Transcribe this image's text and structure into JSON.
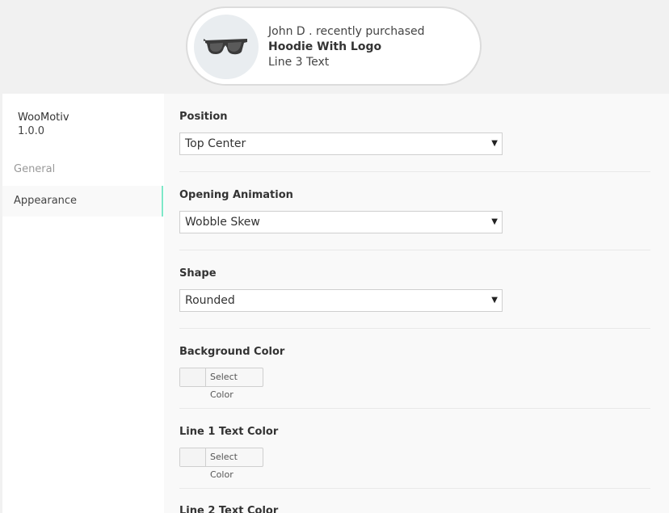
{
  "preview": {
    "image_icon": "sunglasses-icon",
    "line1": "John D . recently purchased",
    "line2": "Hoodie With Logo",
    "line3": "Line 3 Text"
  },
  "sidebar": {
    "plugin_name": "WooMotiv",
    "version": "1.0.0",
    "items": [
      {
        "label": "General",
        "active": false
      },
      {
        "label": "Appearance",
        "active": true
      }
    ],
    "accent_color": "#7ee8c8"
  },
  "settings": {
    "position": {
      "label": "Position",
      "value": "Top Center"
    },
    "opening_animation": {
      "label": "Opening Animation",
      "value": "Wobble Skew"
    },
    "shape": {
      "label": "Shape",
      "value": "Rounded"
    },
    "background_color": {
      "label": "Background Color",
      "button": "Select Color"
    },
    "line1_color": {
      "label": "Line 1 Text Color",
      "button": "Select Color"
    },
    "line2_color": {
      "label": "Line 2 Text Color"
    }
  }
}
